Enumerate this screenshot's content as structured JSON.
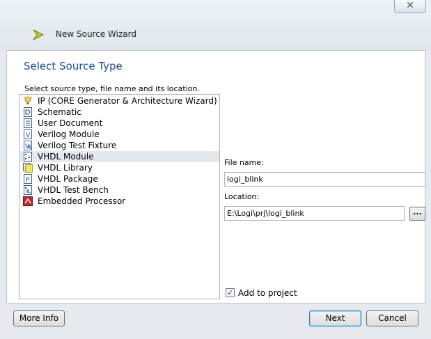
{
  "window": {
    "title": "New Source Wizard",
    "close_glyph": "✕"
  },
  "page": {
    "heading": "Select Source Type",
    "instruction": "Select source type, file name and its location."
  },
  "source_types": [
    {
      "label": "IP (CORE Generator & Architecture Wizard)",
      "icon": "ip-bulb-icon",
      "selected": false
    },
    {
      "label": "Schematic",
      "icon": "schematic-icon",
      "selected": false
    },
    {
      "label": "User Document",
      "icon": "document-icon",
      "selected": false
    },
    {
      "label": "Verilog Module",
      "icon": "verilog-module-icon",
      "selected": false
    },
    {
      "label": "Verilog Test Fixture",
      "icon": "verilog-test-fixture-icon",
      "selected": false
    },
    {
      "label": "VHDL Module",
      "icon": "vhdl-module-icon",
      "selected": true
    },
    {
      "label": "VHDL Library",
      "icon": "vhdl-library-icon",
      "selected": false
    },
    {
      "label": "VHDL Package",
      "icon": "vhdl-package-icon",
      "selected": false
    },
    {
      "label": "VHDL Test Bench",
      "icon": "vhdl-test-bench-icon",
      "selected": false
    },
    {
      "label": "Embedded Processor",
      "icon": "embedded-processor-icon",
      "selected": false
    }
  ],
  "form": {
    "file_name_label": "File name:",
    "file_name_value": "logi_blink",
    "location_label": "Location:",
    "location_value": "E:\\Logi\\prj\\logi_blink",
    "browse_label": "...",
    "add_to_project_label": "Add to project",
    "add_to_project_checked": true
  },
  "buttons": {
    "more_info": "More Info",
    "next": "Next",
    "cancel": "Cancel"
  },
  "colors": {
    "heading": "#1a4f9a",
    "selection": "#e5e8ed",
    "frame": "#e6eaef"
  }
}
